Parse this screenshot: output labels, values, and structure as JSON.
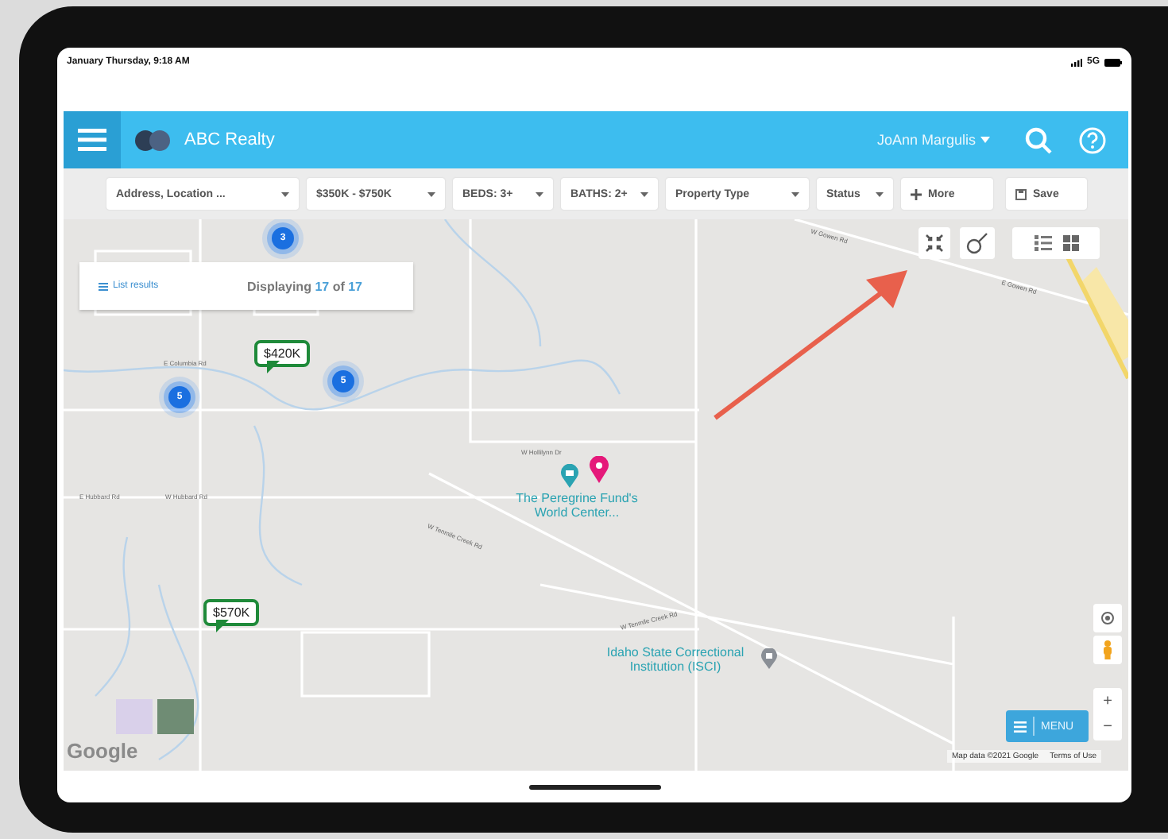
{
  "status_bar": {
    "time": "January Thursday, 9:18 AM",
    "network": "5G"
  },
  "header": {
    "brand": "ABC Realty",
    "user": "JoAnn Margulis"
  },
  "filters": [
    {
      "kind": "dropdown",
      "label": "Address, Location ..."
    },
    {
      "kind": "dropdown",
      "label": "$350K - $750K"
    },
    {
      "kind": "dropdown",
      "label": "BEDS: 3+"
    },
    {
      "kind": "dropdown",
      "label": "BATHS: 2+"
    },
    {
      "kind": "dropdown",
      "label": "Property Type"
    },
    {
      "kind": "dropdown",
      "label": "Status"
    },
    {
      "kind": "add",
      "label": "More"
    },
    {
      "kind": "save",
      "label": "Save"
    }
  ],
  "map": {
    "results_panel": {
      "link": "List results",
      "summary": "Displaying **17** of **17**"
    },
    "clusters": [
      {
        "count": "3"
      },
      {
        "count": "5"
      },
      {
        "count": "5"
      }
    ],
    "price_markers": [
      {
        "price": "$420K"
      },
      {
        "price": "$570K"
      }
    ],
    "places": [
      {
        "kind": "camera",
        "name": "The Peregrine Fund's World Center..."
      },
      {
        "kind": "building",
        "name": "Idaho State Correctional Institution (ISCI)"
      }
    ],
    "street_labels": [
      {
        "text": "E Columbia Rd"
      },
      {
        "text": "E Hubbard Rd"
      },
      {
        "text": "W Hubbard Rd"
      },
      {
        "text": "W Gowen Rd"
      },
      {
        "text": "E Gowen Rd"
      },
      {
        "text": "W Hollilynn Dr"
      },
      {
        "text": "W Tenmile Creek Rd"
      },
      {
        "text": "W Tenmile Creek Rd"
      }
    ],
    "menu_button": "MENU",
    "zoom_in": "+",
    "zoom_out": "−",
    "logo": "Google",
    "attribution": "Map data ©2021 Google",
    "terms_link": "Terms of Use"
  }
}
